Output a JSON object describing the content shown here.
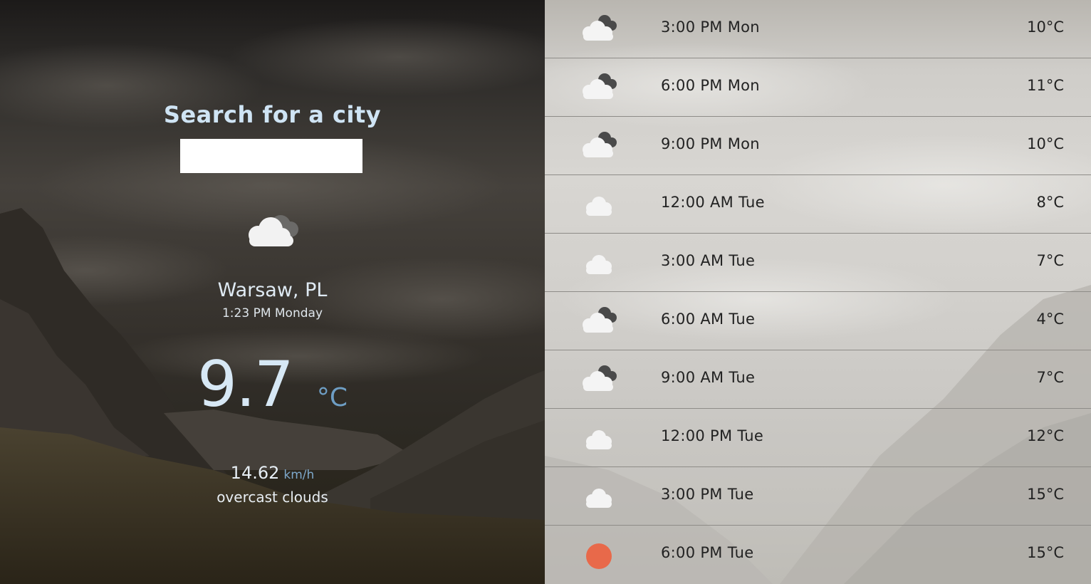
{
  "search": {
    "title": "Search for a city",
    "value": "",
    "placeholder": ""
  },
  "current": {
    "icon": "overcast-clouds-icon",
    "city": "Warsaw, PL",
    "datetime": "1:23 PM Monday",
    "temperature": "9.7",
    "temperature_unit": "°C",
    "wind_speed": "14.62",
    "wind_unit": "km/h",
    "description": "overcast clouds"
  },
  "forecast": [
    {
      "time": "3:00 PM Mon",
      "temp": "10°C",
      "icon": "broken-clouds-icon"
    },
    {
      "time": "6:00 PM Mon",
      "temp": "11°C",
      "icon": "broken-clouds-icon"
    },
    {
      "time": "9:00 PM Mon",
      "temp": "10°C",
      "icon": "broken-clouds-icon"
    },
    {
      "time": "12:00 AM Tue",
      "temp": "8°C",
      "icon": "cloud-icon"
    },
    {
      "time": "3:00 AM Tue",
      "temp": "7°C",
      "icon": "cloud-icon"
    },
    {
      "time": "6:00 AM Tue",
      "temp": "4°C",
      "icon": "broken-clouds-icon"
    },
    {
      "time": "9:00 AM Tue",
      "temp": "7°C",
      "icon": "broken-clouds-icon"
    },
    {
      "time": "12:00 PM Tue",
      "temp": "12°C",
      "icon": "cloud-icon"
    },
    {
      "time": "3:00 PM Tue",
      "temp": "15°C",
      "icon": "cloud-icon"
    },
    {
      "time": "6:00 PM Tue",
      "temp": "15°C",
      "icon": "sun-icon"
    }
  ],
  "colors": {
    "title": "#cfe4f4",
    "unit_accent": "#6e9ec4",
    "sun": "#e8694a",
    "row_divider": "#8e8c88"
  }
}
